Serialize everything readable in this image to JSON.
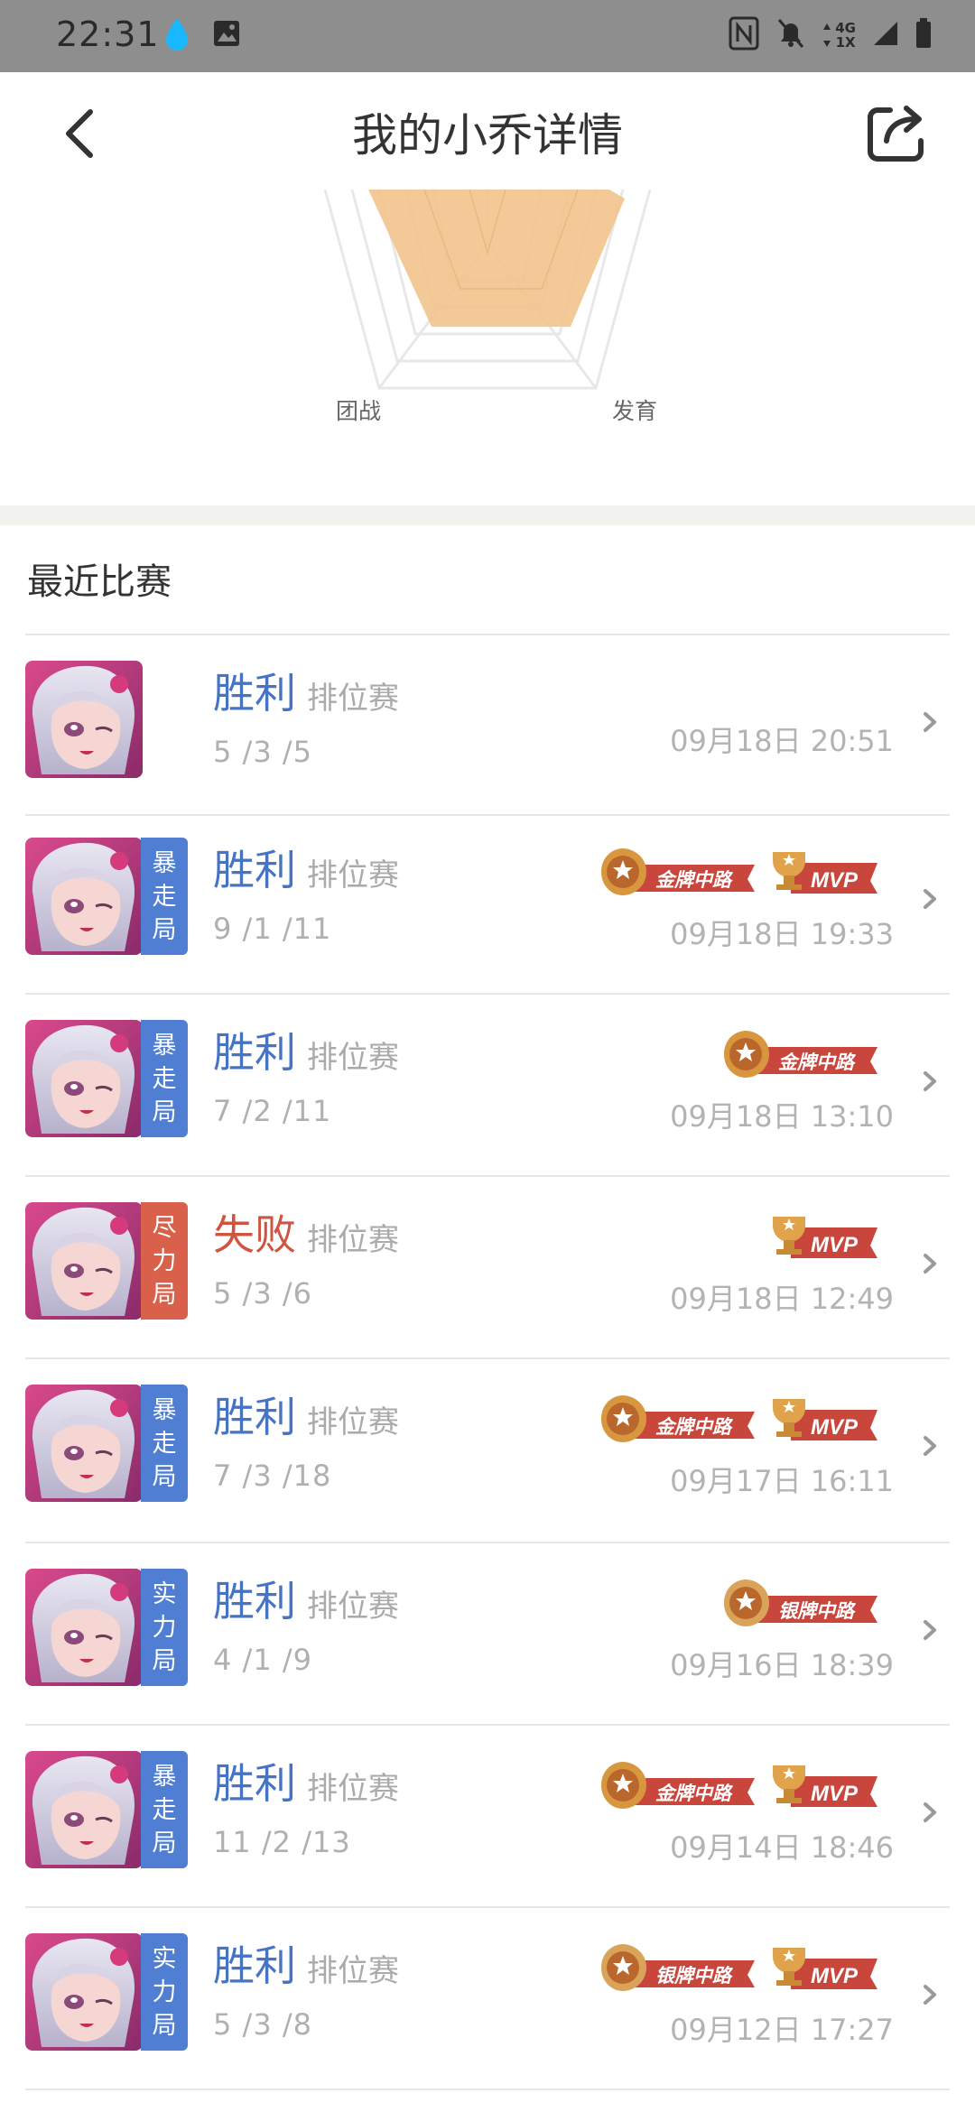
{
  "status": {
    "time": "22:31",
    "net_top": "4G",
    "net_bottom": "1X"
  },
  "header": {
    "title": "我的小乔详情"
  },
  "radar": {
    "labels": [
      "团战",
      "发育"
    ]
  },
  "section": {
    "title": "最近比赛"
  },
  "badge_labels": {
    "gold_mid": "金牌中路",
    "silver_mid": "银牌中路",
    "mvp": "MVP"
  },
  "colors": {
    "win": "#4673c3",
    "lose": "#cf5542",
    "tag_blue": "#4f7ed2",
    "tag_red": "#d9604a",
    "badge_red": "#c9463c",
    "radar_fill": "#f2c48c"
  },
  "matches": [
    {
      "result": "胜利",
      "outcome": "win",
      "type": "排位赛",
      "kda": "5 /3 /5",
      "datetime": "09月18日 20:51",
      "tag": "",
      "tag_color": "",
      "badges": []
    },
    {
      "result": "胜利",
      "outcome": "win",
      "type": "排位赛",
      "kda": "9 /1 /11",
      "datetime": "09月18日 19:33",
      "tag": "暴走局",
      "tag_color": "blue",
      "badges": [
        "gold_mid",
        "mvp"
      ]
    },
    {
      "result": "胜利",
      "outcome": "win",
      "type": "排位赛",
      "kda": "7 /2 /11",
      "datetime": "09月18日 13:10",
      "tag": "暴走局",
      "tag_color": "blue",
      "badges": [
        "gold_mid"
      ]
    },
    {
      "result": "失败",
      "outcome": "lose",
      "type": "排位赛",
      "kda": "5 /3 /6",
      "datetime": "09月18日 12:49",
      "tag": "尽力局",
      "tag_color": "red",
      "badges": [
        "mvp"
      ]
    },
    {
      "result": "胜利",
      "outcome": "win",
      "type": "排位赛",
      "kda": "7 /3 /18",
      "datetime": "09月17日 16:11",
      "tag": "暴走局",
      "tag_color": "blue",
      "badges": [
        "gold_mid",
        "mvp"
      ]
    },
    {
      "result": "胜利",
      "outcome": "win",
      "type": "排位赛",
      "kda": "4 /1 /9",
      "datetime": "09月16日 18:39",
      "tag": "实力局",
      "tag_color": "blue",
      "badges": [
        "silver_mid"
      ]
    },
    {
      "result": "胜利",
      "outcome": "win",
      "type": "排位赛",
      "kda": "11 /2 /13",
      "datetime": "09月14日 18:46",
      "tag": "暴走局",
      "tag_color": "blue",
      "badges": [
        "gold_mid",
        "mvp"
      ]
    },
    {
      "result": "胜利",
      "outcome": "win",
      "type": "排位赛",
      "kda": "5 /3 /8",
      "datetime": "09月12日 17:27",
      "tag": "实力局",
      "tag_color": "blue",
      "badges": [
        "silver_mid",
        "mvp"
      ]
    }
  ]
}
